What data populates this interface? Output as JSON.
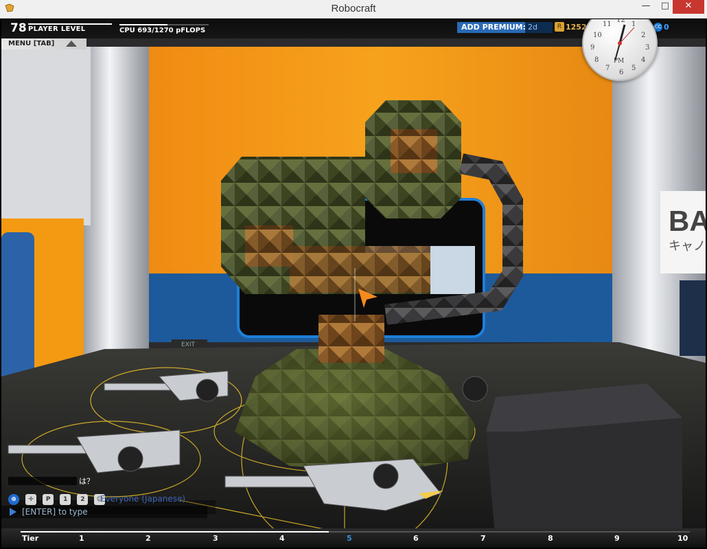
{
  "window": {
    "title": "Robocraft",
    "minimize": "—",
    "maximize": "□",
    "close": "✕"
  },
  "hud": {
    "level_value": "78",
    "level_label": "PLAYER LEVEL",
    "cpu_label": "CPU 693/1270 pFLOPS",
    "cpu_used": 693,
    "cpu_max": 1270,
    "premium_button": "ADD PREMIUM:",
    "premium_value": "2d",
    "robits_value": "1252",
    "cosmetic_credits_value": "0",
    "menu_label": "MENU [TAB]"
  },
  "clock": {
    "numerals": [
      "12",
      "1",
      "2",
      "3",
      "4",
      "5",
      "6",
      "7",
      "8",
      "9",
      "10",
      "11"
    ],
    "ampm": "PM"
  },
  "chat": {
    "message_text": "は？",
    "channel_label": "Everyone (Japanese)",
    "input_placeholder": "[ENTER] to type",
    "icons": [
      "globe-icon",
      "crosshair-icon",
      "party-icon",
      "person-1-icon",
      "person-2-icon",
      "friends-icon"
    ],
    "icon_labels": {
      "party": "P",
      "person1": "1",
      "person2": "2"
    }
  },
  "tier_bar": {
    "label": "Tier",
    "tiers": [
      "1",
      "2",
      "3",
      "4",
      "5",
      "6",
      "7",
      "8",
      "9",
      "10"
    ],
    "active_tier": "5"
  },
  "scene": {
    "exit_sign": "EXIT",
    "banner_text": "BA",
    "banner_sub": "キャノ"
  },
  "colors": {
    "premium": "#2a6ab5",
    "robits": "#e7b24a",
    "cc": "#3b9dff",
    "active_tier": "#3b8fe0"
  }
}
